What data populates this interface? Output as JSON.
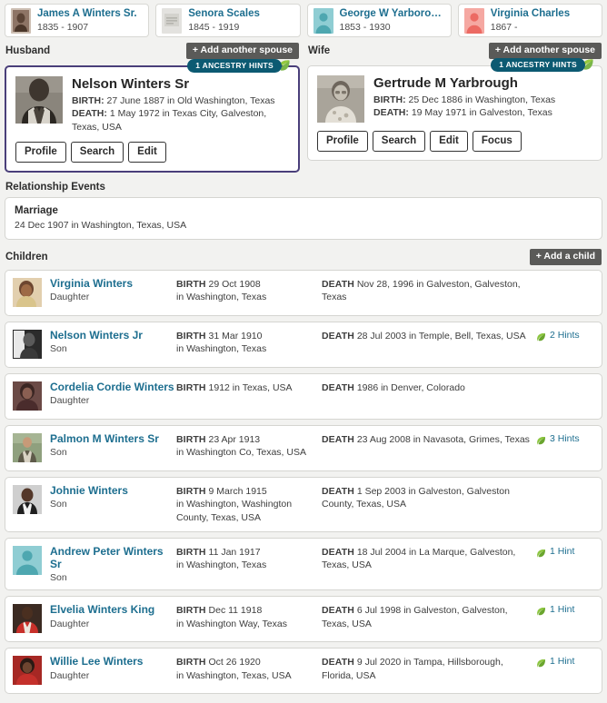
{
  "grandparents": [
    {
      "name": "James A Winters Sr.",
      "dates": "1835 - 1907",
      "avatar": "photo-sepia-man"
    },
    {
      "name": "Senora Scales",
      "dates": "1845 - 1919",
      "avatar": "photo-faded-document"
    },
    {
      "name": "George W Yarborough",
      "dates": "1853 - 1930",
      "avatar": "silhouette-male-teal"
    },
    {
      "name": "Virginia Charles",
      "dates": "1867 -",
      "avatar": "silhouette-female-pink"
    }
  ],
  "husband": {
    "section_label": "Husband",
    "add_spouse_label": "+ Add another spouse",
    "hint_badge": "1 ANCESTRY HINTS",
    "name": "Nelson Winters Sr",
    "birth_label": "BIRTH:",
    "birth_value": "27 June 1887 in Old Washington, Texas",
    "death_label": "DEATH:",
    "death_value": "1 May 1972 in Texas City, Galveston, Texas, USA",
    "avatar": "photo-man-suit-bw",
    "buttons": [
      "Profile",
      "Search",
      "Edit"
    ]
  },
  "wife": {
    "section_label": "Wife",
    "add_spouse_label": "+ Add another spouse",
    "hint_badge": "1 ANCESTRY HINTS",
    "name": "Gertrude M Yarbrough",
    "birth_label": "BIRTH:",
    "birth_value": "25 Dec 1886 in Washington, Texas",
    "death_label": "DEATH:",
    "death_value": "19 May 1971 in Galveston, Texas",
    "avatar": "photo-woman-glasses-bw",
    "buttons": [
      "Profile",
      "Search",
      "Edit",
      "Focus"
    ]
  },
  "relationship_events": {
    "section_label": "Relationship Events",
    "events": [
      {
        "title": "Marriage",
        "detail": "24 Dec 1907 in Washington, Texas, USA"
      }
    ]
  },
  "children": {
    "section_label": "Children",
    "add_child_label": "+ Add a child",
    "birth_label": "BIRTH",
    "death_label": "DEATH",
    "rows": [
      {
        "name": "Virginia Winters",
        "relation": "Daughter",
        "avatar": "photo-woman-color",
        "birth_date": "29 Oct 1908",
        "birth_place": "in Washington, Texas",
        "death_date": "Nov 28, 1996",
        "death_place": "in Galveston, Galveston, Texas",
        "hints": ""
      },
      {
        "name": "Nelson Winters Jr",
        "relation": "Son",
        "avatar": "photo-man-bw",
        "birth_date": "31 Mar 1910",
        "birth_place": "in Washington, Texas",
        "death_date": "28 Jul 2003",
        "death_place": "in Temple, Bell, Texas, USA",
        "hints": "2 Hints"
      },
      {
        "name": "Cordelia Cordie Winters",
        "relation": "Daughter",
        "avatar": "photo-woman-dark",
        "birth_date": "1912",
        "birth_place": "in Texas, USA",
        "death_date": "1986",
        "death_place": "in Denver, Colorado",
        "hints": ""
      },
      {
        "name": "Palmon M Winters Sr",
        "relation": "Son",
        "avatar": "photo-man-outdoor",
        "birth_date": "23 Apr 1913",
        "birth_place": "in Washington Co, Texas, USA",
        "death_date": "23 Aug 2008",
        "death_place": "in Navasota, Grimes, Texas",
        "hints": "3 Hints"
      },
      {
        "name": "Johnie Winters",
        "relation": "Son",
        "avatar": "photo-man-portrait",
        "birth_date": "9 March 1915",
        "birth_place": "in Washington, Washington County, Texas, USA",
        "death_date": "1 Sep 2003",
        "death_place": "in Galveston, Galveston County, Texas, USA",
        "hints": ""
      },
      {
        "name": "Andrew Peter Winters Sr",
        "relation": "Son",
        "avatar": "silhouette-male-teal",
        "birth_date": "11 Jan 1917",
        "birth_place": "in Washington, Texas",
        "death_date": "18 Jul 2004",
        "death_place": "in La Marque, Galveston, Texas, USA",
        "hints": "1 Hint"
      },
      {
        "name": "Elvelia Winters King",
        "relation": "Daughter",
        "avatar": "photo-woman-red",
        "birth_date": "Dec 11 1918",
        "birth_place": "in Washington Way, Texas",
        "death_date": "6 Jul 1998",
        "death_place": "in Galveston, Galveston, Texas, USA",
        "hints": "1 Hint"
      },
      {
        "name": "Willie Lee Winters",
        "relation": "Daughter",
        "avatar": "photo-woman-red2",
        "birth_date": "Oct 26 1920",
        "birth_place": "in Washington, Texas, USA",
        "death_date": "9 Jul 2020",
        "death_place": "in Tampa, Hillsborough, Florida, USA",
        "hints": "1 Hint"
      }
    ]
  },
  "colors": {
    "link": "#1d6e8f",
    "hint_pill": "#0c5a72",
    "leaf_green": "#5aa02c",
    "dark_button": "#5a5a58",
    "focus_border": "#4a3f7a",
    "page_bg": "#f2f2f0"
  }
}
